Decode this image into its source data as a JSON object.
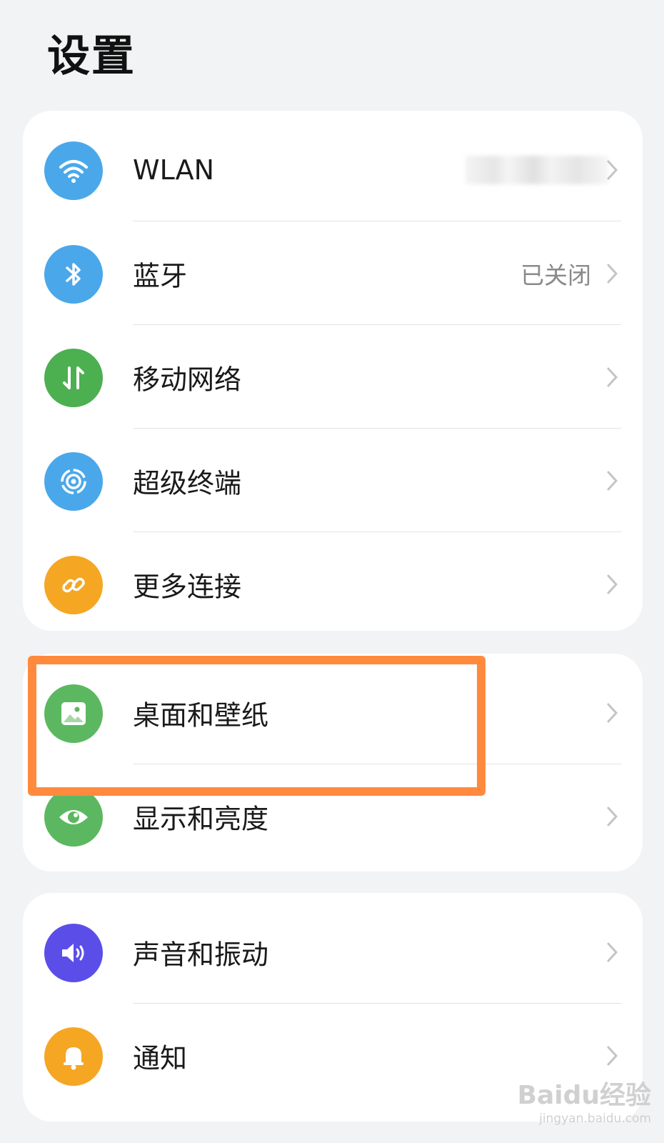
{
  "page": {
    "title": "设置"
  },
  "groups": [
    {
      "items": [
        {
          "label": "WLAN",
          "value": "",
          "icon": "wifi-icon",
          "color": "#4aa8ea"
        },
        {
          "label": "蓝牙",
          "value": "已关闭",
          "icon": "bluetooth-icon",
          "color": "#4aa8ea"
        },
        {
          "label": "移动网络",
          "value": "",
          "icon": "mobile-data-icon",
          "color": "#4caf50"
        },
        {
          "label": "超级终端",
          "value": "",
          "icon": "super-device-icon",
          "color": "#4aa8ea"
        },
        {
          "label": "更多连接",
          "value": "",
          "icon": "link-icon",
          "color": "#f5a623"
        }
      ]
    },
    {
      "items": [
        {
          "label": "桌面和壁纸",
          "value": "",
          "icon": "wallpaper-icon",
          "color": "#5cb860"
        },
        {
          "label": "显示和亮度",
          "value": "",
          "icon": "eye-icon",
          "color": "#5cb860"
        }
      ]
    },
    {
      "items": [
        {
          "label": "声音和振动",
          "value": "",
          "icon": "speaker-icon",
          "color": "#5b4ee8"
        },
        {
          "label": "通知",
          "value": "",
          "icon": "bell-icon",
          "color": "#f5a623"
        }
      ]
    }
  ],
  "highlight": {
    "color": "#ff8a3d",
    "target": "桌面和壁纸"
  },
  "watermark": {
    "brand": "Baidu经验",
    "url": "jingyan.baidu.com"
  }
}
